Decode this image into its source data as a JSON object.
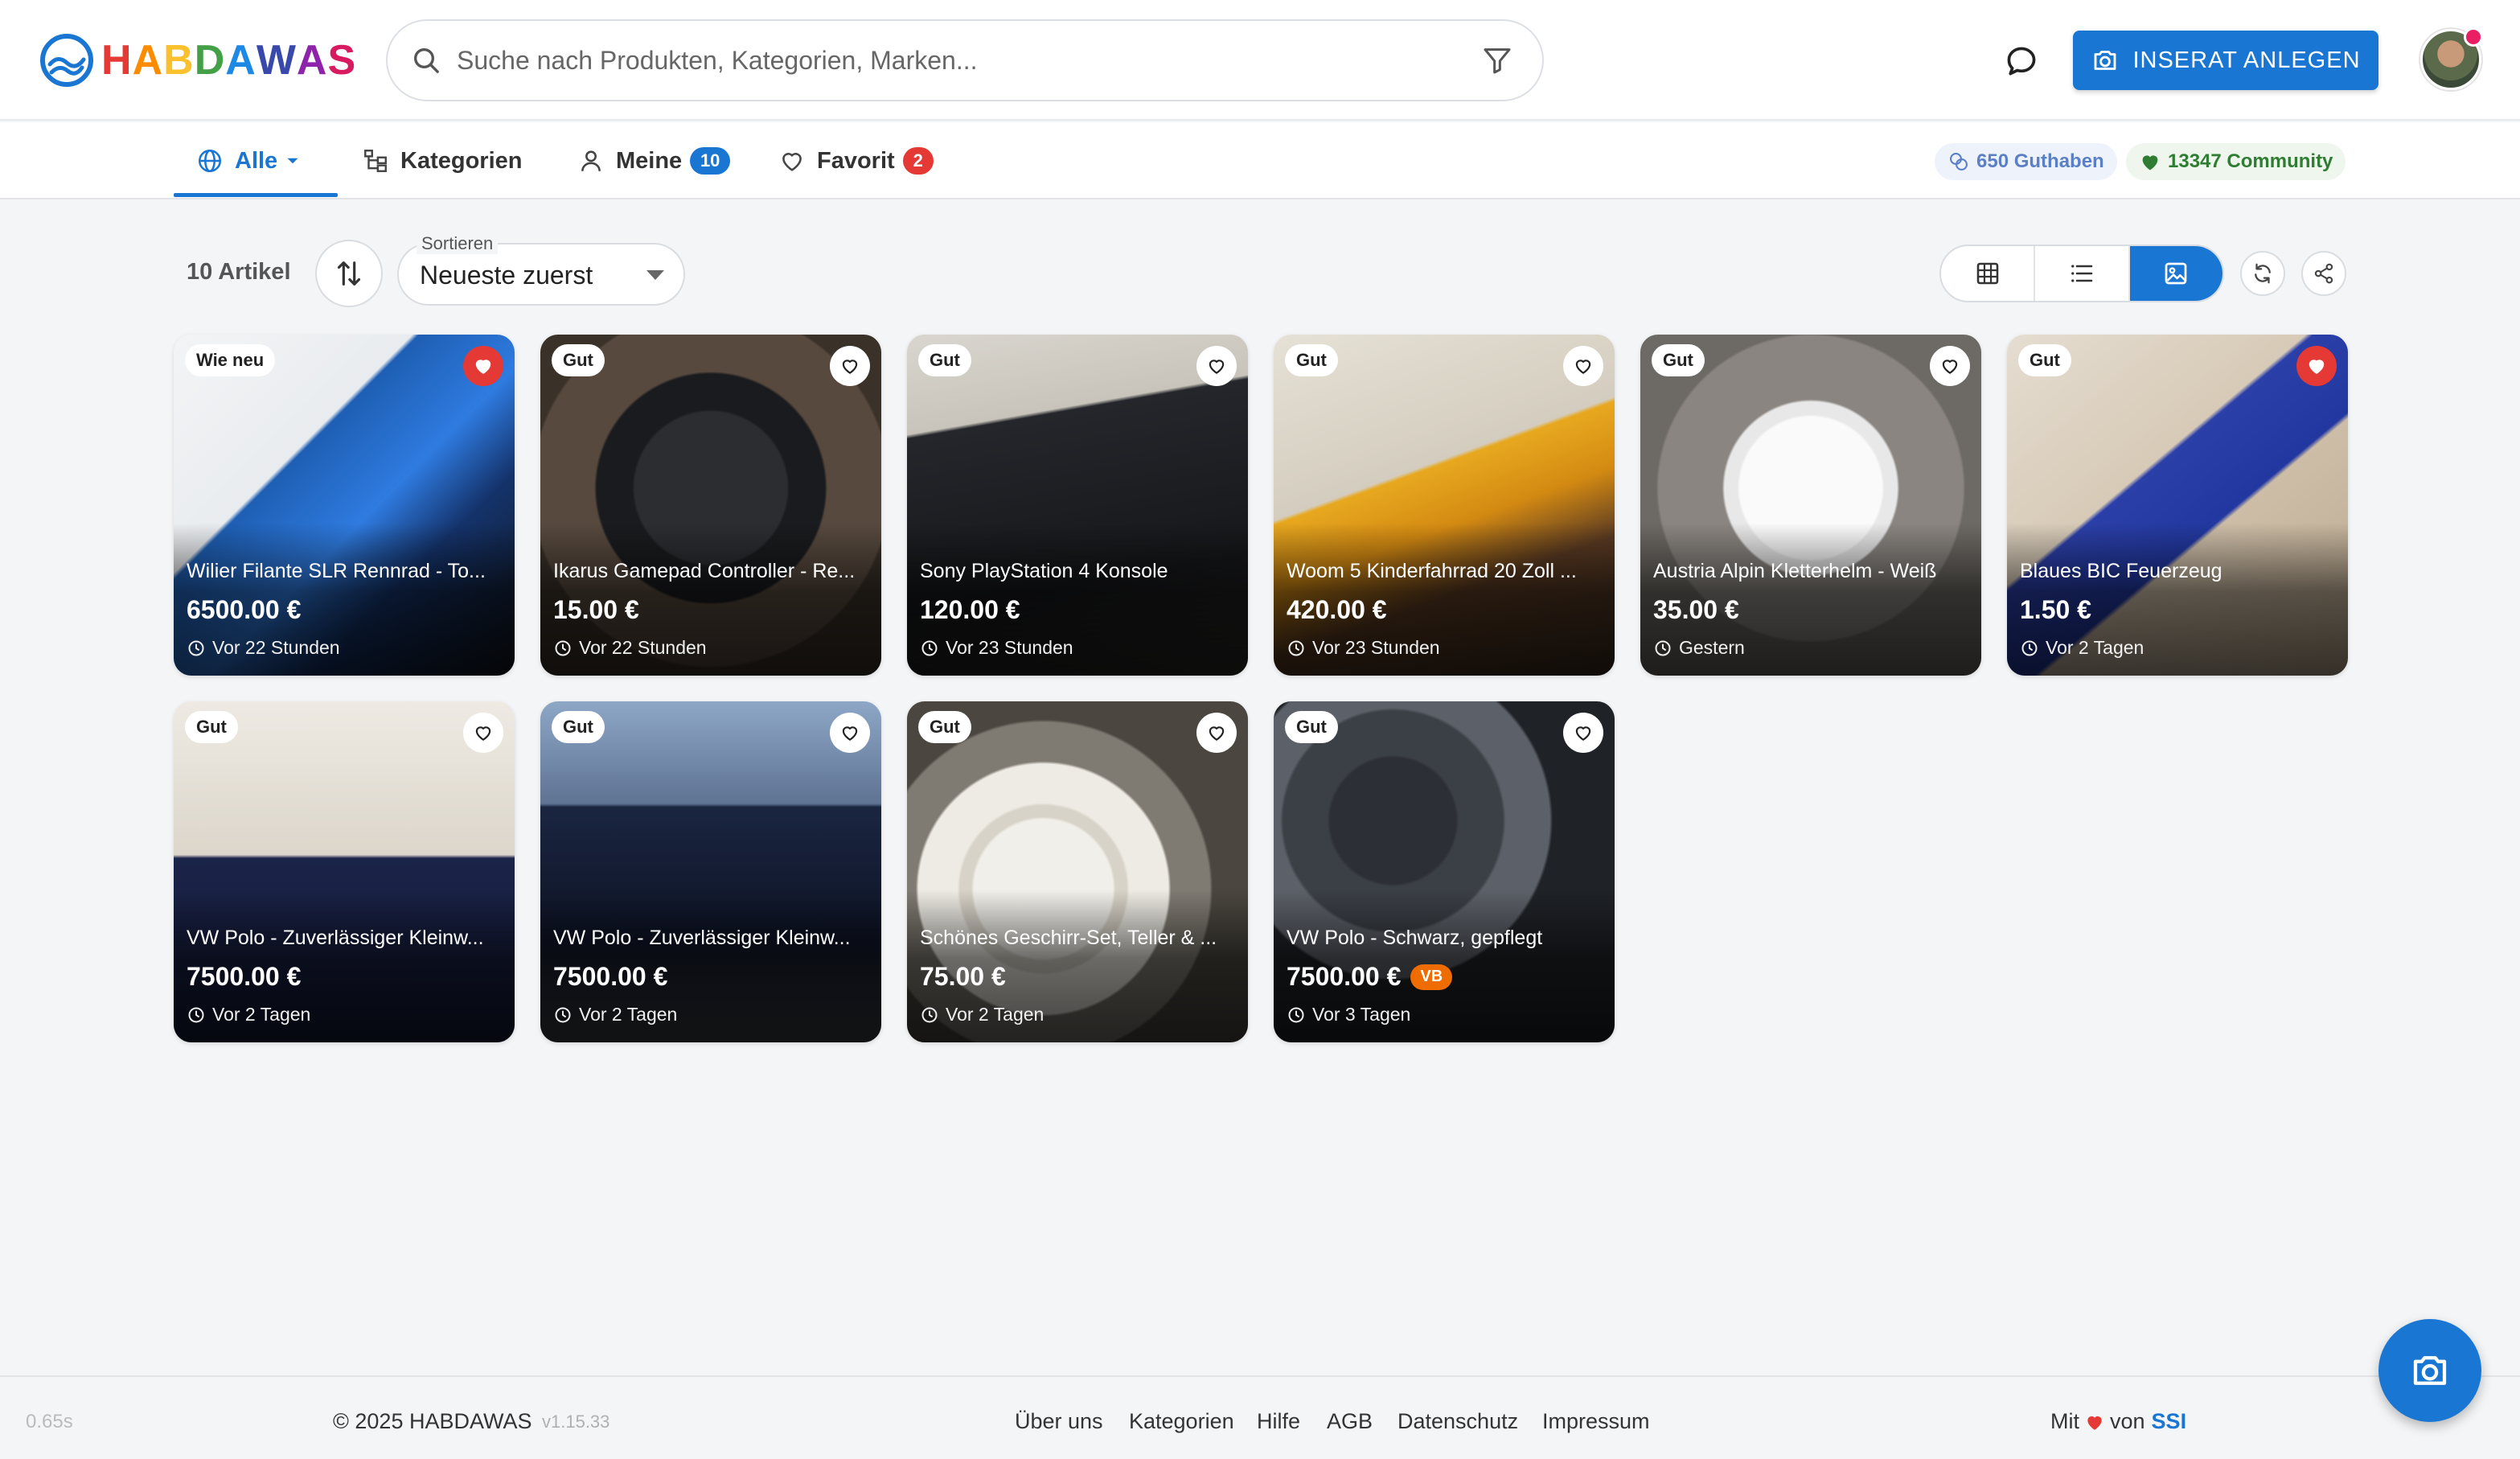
{
  "brand": {
    "name_letters": [
      {
        "ch": "H",
        "color": "#e53935"
      },
      {
        "ch": "A",
        "color": "#fb8c00"
      },
      {
        "ch": "B",
        "color": "#fbc02d"
      },
      {
        "ch": "D",
        "color": "#43a047"
      },
      {
        "ch": "A",
        "color": "#1e88e5"
      },
      {
        "ch": "W",
        "color": "#3949ab"
      },
      {
        "ch": "A",
        "color": "#8e24aa"
      },
      {
        "ch": "S",
        "color": "#d81b60"
      }
    ],
    "accent": "#1976d2"
  },
  "search": {
    "placeholder": "Suche nach Produkten, Kategorien, Marken..."
  },
  "header": {
    "cta_label": "INSERAT ANLEGEN"
  },
  "nav": {
    "tabs": [
      {
        "label": "Alle",
        "active": true
      },
      {
        "label": "Kategorien"
      },
      {
        "label": "Meine",
        "badge": "10",
        "badge_color": "#1976d2"
      },
      {
        "label": "Favorit",
        "badge": "2",
        "badge_color": "#e53935"
      }
    ],
    "credits": "650 Guthaben",
    "community": "13347 Community"
  },
  "toolbar": {
    "count": "10 Artikel",
    "sort_label": "Sortieren",
    "sort_value": "Neueste zuerst"
  },
  "listings": [
    {
      "condition": "Wie neu",
      "title": "Wilier Filante SLR Rennrad - To...",
      "price": "6500.00 €",
      "time": "Vor 22 Stunden",
      "favorite": true
    },
    {
      "condition": "Gut",
      "title": "Ikarus Gamepad Controller - Re...",
      "price": "15.00 €",
      "time": "Vor 22 Stunden",
      "favorite": false
    },
    {
      "condition": "Gut",
      "title": "Sony PlayStation 4 Konsole",
      "price": "120.00 €",
      "time": "Vor 23 Stunden",
      "favorite": false
    },
    {
      "condition": "Gut",
      "title": "Woom 5 Kinderfahrrad 20 Zoll ...",
      "price": "420.00 €",
      "time": "Vor 23 Stunden",
      "favorite": false
    },
    {
      "condition": "Gut",
      "title": "Austria Alpin Kletterhelm - Weiß",
      "price": "35.00 €",
      "time": "Gestern",
      "favorite": false
    },
    {
      "condition": "Gut",
      "title": "Blaues BIC Feuerzeug",
      "price": "1.50 €",
      "time": "Vor 2 Tagen",
      "favorite": true
    },
    {
      "condition": "Gut",
      "title": "VW Polo - Zuverlässiger Kleinw...",
      "price": "7500.00 €",
      "time": "Vor 2 Tagen",
      "favorite": false
    },
    {
      "condition": "Gut",
      "title": "VW Polo - Zuverlässiger Kleinw...",
      "price": "7500.00 €",
      "time": "Vor 2 Tagen",
      "favorite": false
    },
    {
      "condition": "Gut",
      "title": "Schönes Geschirr-Set, Teller & ...",
      "price": "75.00 €",
      "time": "Vor 2 Tagen",
      "favorite": false
    },
    {
      "condition": "Gut",
      "title": "VW Polo - Schwarz, gepflegt",
      "price": "7500.00 €",
      "badge": "VB",
      "time": "Vor 3 Tagen",
      "favorite": false
    }
  ],
  "footer": {
    "load_time": "0.65s",
    "copyright": "© 2025 HABDAWAS",
    "version": "v1.15.33",
    "links": [
      "Über uns",
      "Kategorien",
      "Hilfe",
      "AGB",
      "Datenschutz",
      "Impressum"
    ],
    "credit_prefix": "Mit",
    "credit_mid": "von",
    "credit_org": "SSI"
  }
}
